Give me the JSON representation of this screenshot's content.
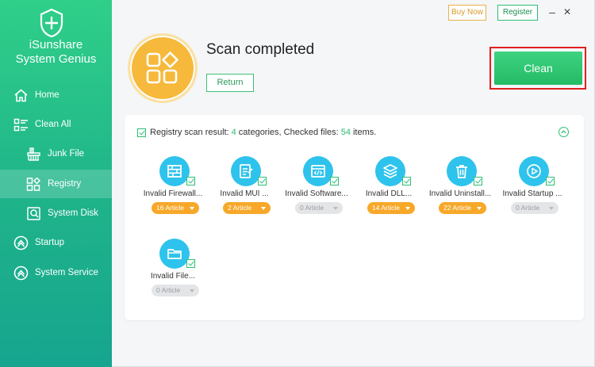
{
  "app": {
    "name_line1": "iSunshare",
    "name_line2": "System Genius"
  },
  "nav": [
    {
      "label": "Home",
      "icon": "home-icon"
    },
    {
      "label": "Clean All",
      "icon": "list-icon"
    },
    {
      "label": "Junk File",
      "icon": "broom-icon"
    },
    {
      "label": "Registry",
      "icon": "grid-icon",
      "active": true
    },
    {
      "label": "System Disk",
      "icon": "disk-icon"
    },
    {
      "label": "Startup",
      "icon": "startup-icon"
    },
    {
      "label": "System Service",
      "icon": "service-icon"
    }
  ],
  "topbar": {
    "buy_label": "Buy Now",
    "register_label": "Register",
    "minimize": "–",
    "close": "✕"
  },
  "status": {
    "title": "Scan completed",
    "return_label": "Return",
    "clean_label": "Clean"
  },
  "result": {
    "prefix": "Registry scan result:",
    "categories_count": "4",
    "mid": "categories, Checked files:",
    "files_count": "54",
    "suffix": "items."
  },
  "categories": [
    {
      "name": "Invalid Firewall...",
      "count_label": "16 Article",
      "active": true,
      "icon": "firewall-icon"
    },
    {
      "name": "Invalid MUI ...",
      "count_label": "2 Article",
      "active": true,
      "icon": "document-icon"
    },
    {
      "name": "Invalid Software...",
      "count_label": "0 Article",
      "active": false,
      "icon": "software-icon"
    },
    {
      "name": "Invalid DLL...",
      "count_label": "14 Article",
      "active": true,
      "icon": "layers-icon"
    },
    {
      "name": "Invalid Uninstall...",
      "count_label": "22 Article",
      "active": true,
      "icon": "trash-icon"
    },
    {
      "name": "Invalid Startup ...",
      "count_label": "0 Article",
      "active": false,
      "icon": "play-icon"
    },
    {
      "name": "Invalid File...",
      "count_label": "0 Article",
      "active": false,
      "icon": "folder-icon"
    }
  ],
  "colors": {
    "accent": "#2bbf73",
    "orange": "#f7a829",
    "icon_blue": "#2ec3ec",
    "alert_red": "#e02020"
  }
}
